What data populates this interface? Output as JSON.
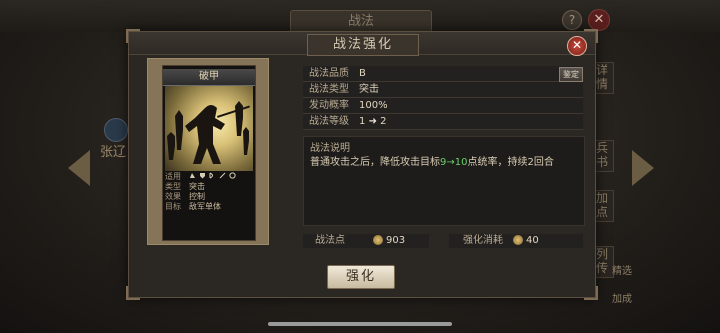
{
  "background": {
    "title": "战法",
    "help": "?",
    "close": "✕",
    "side_name": "张辽",
    "right_tabs": [
      "详情",
      "兵书",
      "加点",
      "列传"
    ],
    "bottom_items": [
      "精选",
      "加成"
    ]
  },
  "dialog": {
    "title": "战法强化",
    "close": "✕"
  },
  "card": {
    "name": "破甲",
    "stats": [
      {
        "key": "适用",
        "value": ""
      },
      {
        "key": "类型",
        "value": "突击"
      },
      {
        "key": "效果",
        "value": "控制"
      },
      {
        "key": "目标",
        "value": "敌军单体"
      }
    ],
    "troop_icons": [
      "cavalry-icon",
      "shield-icon",
      "bow-icon",
      "spear-icon",
      "siege-icon"
    ]
  },
  "info": {
    "rows": [
      {
        "key": "战法品质",
        "value": "B"
      },
      {
        "key": "战法类型",
        "value": "突击"
      },
      {
        "key": "发动概率",
        "value": "100%"
      },
      {
        "key": "战法等级",
        "value_from": "1",
        "value_to": "2"
      }
    ],
    "appraise_label": "鉴定",
    "desc_title": "战法说明",
    "desc_before": "普通攻击之后，降低攻击目标",
    "desc_from": "9",
    "desc_to": "10",
    "desc_after": "点统率，持续2回合"
  },
  "points": {
    "left_label": "战法点",
    "left_value": "903",
    "right_label": "强化消耗",
    "right_value": "40"
  },
  "enhance_label": "强化"
}
